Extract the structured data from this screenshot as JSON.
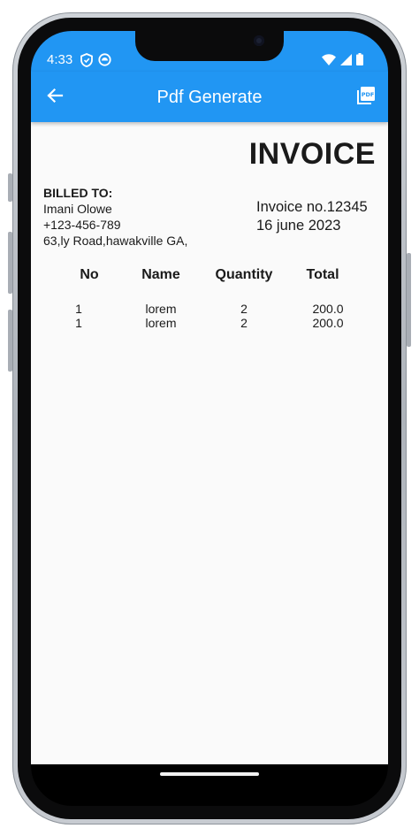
{
  "status_bar": {
    "time": "4:33",
    "left_icons": [
      "shield-icon",
      "circle-app-icon"
    ],
    "right_icons": [
      "wifi-icon",
      "cell-signal-icon",
      "battery-icon"
    ]
  },
  "app_bar": {
    "title": "Pdf Generate",
    "back_icon": "arrow-back-icon",
    "action_icon": "pdf-icon",
    "color": "#2196f3"
  },
  "invoice": {
    "heading": "INVOICE",
    "billed_to": {
      "label": "BILLED TO:",
      "name": "Imani Olowe",
      "phone": "+123-456-789",
      "address": "63,ly Road,hawakville GA,"
    },
    "number_text": "Invoice no.12345",
    "date": "16 june 2023"
  },
  "table": {
    "headers": {
      "no": "No",
      "name": "Name",
      "quantity": "Quantity",
      "total": "Total"
    },
    "rows": [
      {
        "no": "1",
        "name": "lorem",
        "quantity": "2",
        "total": "200.0"
      },
      {
        "no": "1",
        "name": "lorem",
        "quantity": "2",
        "total": "200.0"
      }
    ]
  }
}
